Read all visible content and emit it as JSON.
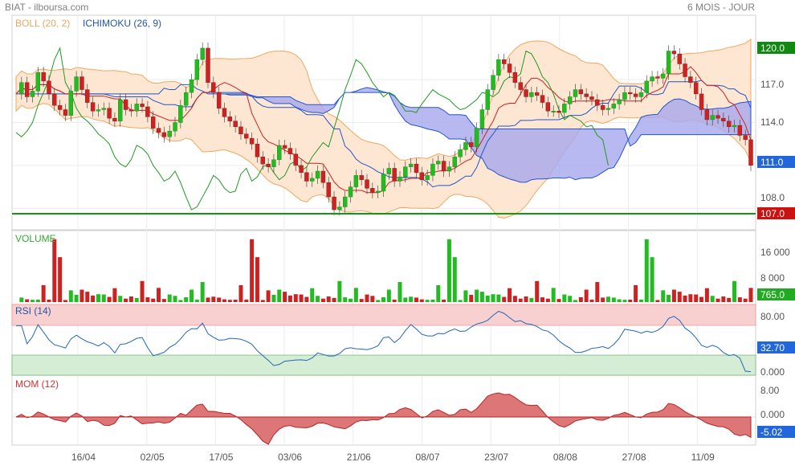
{
  "header": {
    "title": "BIAT - ilboursa.com",
    "period": "6 MOIS - JOUR"
  },
  "colors": {
    "up": "#22bb22",
    "down": "#cc2222",
    "boll_fill": "#fde6d2",
    "boll_line": "#f0a860",
    "ichimoku_cloud": "#a8a8ee",
    "ichimoku_line": "#2255cc",
    "lagging": "#229922",
    "tenkan": "#cc2222",
    "support": "#119911",
    "rsi_over": "#f9d0d0",
    "rsi_under": "#d5ecd5",
    "rsi_line": "#2266bb",
    "mom_fill": "#dd7777",
    "mom_line": "#bb2222",
    "price_label": "#2266dd",
    "top_label": "#118811",
    "bottom_label": "#cc1111"
  },
  "chart_data": [
    {
      "type": "candlestick",
      "panel": "price",
      "indicators": [
        "BOLL (20, 2)",
        "ICHIMOKU (26, 9)"
      ],
      "ylim": [
        106.5,
        121.5
      ],
      "yticks": [
        "117.0",
        "114.0",
        "111.0",
        "108.0"
      ],
      "last_price": "111.0",
      "level_top": "120.0",
      "level_support": "107.0",
      "xticks": [
        "16/04",
        "02/05",
        "17/05",
        "03/06",
        "21/06",
        "08/07",
        "23/07",
        "08/08",
        "27/08",
        "11/09"
      ],
      "close_series": [
        116.0,
        116.8,
        115.8,
        116.2,
        117.5,
        116.9,
        116.0,
        115.2,
        114.9,
        114.5,
        116.2,
        117.2,
        116.3,
        115.4,
        114.8,
        114.9,
        115.0,
        114.3,
        114.1,
        115.6,
        114.9,
        114.8,
        115.3,
        115.1,
        114.4,
        113.6,
        113.3,
        113.0,
        113.4,
        114.0,
        115.2,
        116.1,
        117.0,
        118.4,
        119.2,
        116.8,
        116.1,
        115.0,
        114.4,
        114.1,
        113.7,
        113.2,
        112.9,
        112.5,
        111.6,
        111.1,
        110.9,
        111.4,
        112.4,
        112.2,
        111.8,
        111.0,
        110.5,
        109.9,
        110.1,
        110.6,
        109.8,
        108.8,
        107.9,
        108.1,
        108.8,
        109.5,
        110.3,
        110.0,
        109.4,
        109.1,
        109.2,
        110.4,
        110.8,
        109.9,
        110.2,
        110.9,
        111.1,
        110.5,
        110.0,
        110.3,
        111.1,
        111.3,
        110.6,
        110.9,
        111.6,
        112.1,
        112.6,
        112.3,
        113.6,
        114.9,
        116.3,
        117.3,
        118.4,
        118.1,
        117.5,
        116.8,
        116.3,
        115.8,
        116.1,
        115.9,
        115.4,
        114.8,
        114.8,
        114.7,
        115.3,
        115.8,
        116.3,
        116.0,
        115.8,
        115.6,
        115.2,
        114.9,
        115.0,
        115.3,
        115.6,
        116.1,
        116.0,
        115.8,
        116.1,
        116.9,
        117.2,
        117.1,
        117.4,
        119.0,
        118.8,
        118.1,
        117.2,
        116.8,
        116.0,
        114.9,
        114.2,
        114.5,
        114.3,
        114.1,
        113.7,
        113.8,
        113.1,
        112.8,
        111.0
      ],
      "candles_shown": 133,
      "volume": {
        "label": "VOLUME",
        "yticks": [
          "16 000",
          "8 000"
        ],
        "last": "765.0",
        "spikes_k": [
          2.6,
          1.3,
          0.8,
          1.1,
          0.7,
          4.9,
          1.2,
          18.2,
          13.0,
          1.0,
          3.4,
          2.1,
          6.0,
          3.0,
          1.9,
          3.8,
          2.2,
          1.5,
          6.7,
          1.8,
          1.0,
          2.7,
          1.2,
          6.1,
          2.3,
          1.0,
          4.1,
          1.5,
          2.2,
          1.8,
          1.0,
          1.4,
          3.6,
          1.2,
          5.8,
          1.3
        ]
      },
      "rsi": {
        "label": "RSI (14)",
        "yticks": [
          "80.00",
          "0.000"
        ],
        "last": "32.70"
      },
      "mom": {
        "label": "MOM (12)",
        "yticks": [
          "8.00",
          "0.000"
        ],
        "last": "-5.02"
      }
    }
  ]
}
